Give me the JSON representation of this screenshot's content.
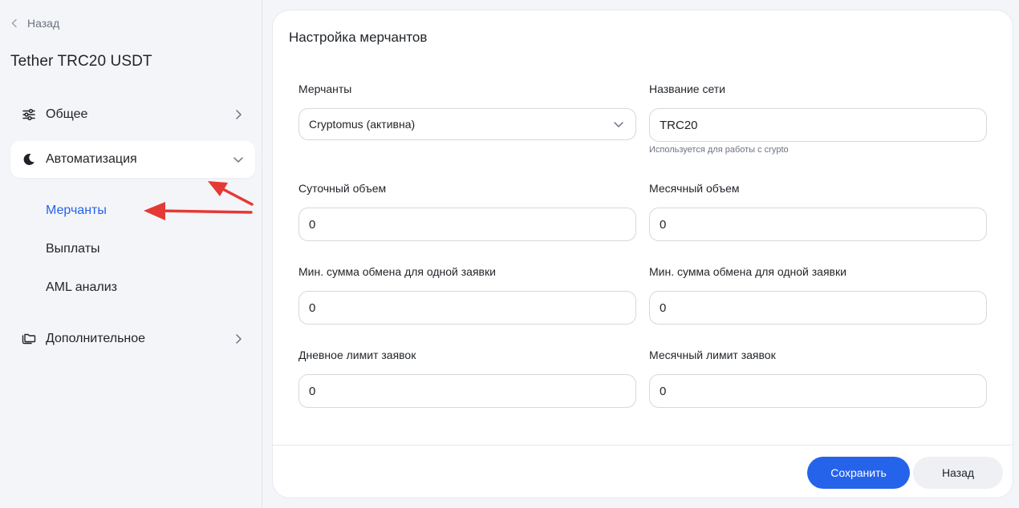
{
  "sidebar": {
    "back_label": "Назад",
    "asset_title": "Tether TRC20 USDT",
    "nav": [
      {
        "label": "Общее",
        "icon": "sliders-icon",
        "expanded": false
      },
      {
        "label": "Автоматизация",
        "icon": "moon-icon",
        "expanded": true
      },
      {
        "label": "Дополнительное",
        "icon": "folders-icon",
        "expanded": false
      }
    ],
    "sub_items": [
      {
        "label": "Мерчанты",
        "selected": true
      },
      {
        "label": "Выплаты",
        "selected": false
      },
      {
        "label": "AML анализ",
        "selected": false
      }
    ]
  },
  "card": {
    "title": "Настройка мерчантов",
    "fields": {
      "merchants": {
        "label": "Мерчанты",
        "value": "Cryptomus (активна)"
      },
      "network_name": {
        "label": "Название сети",
        "value": "TRC20",
        "hint": "Используется для работы с crypto"
      },
      "daily_volume": {
        "label": "Суточный объем",
        "value": "0"
      },
      "monthly_volume": {
        "label": "Месячный объем",
        "value": "0"
      },
      "min_amount_left": {
        "label": "Мин. сумма обмена для одной заявки",
        "value": "0"
      },
      "min_amount_right": {
        "label": "Мин. сумма обмена для одной заявки",
        "value": "0"
      },
      "daily_limit": {
        "label": "Дневное лимит заявок",
        "value": "0"
      },
      "monthly_limit": {
        "label": "Месячный лимит заявок",
        "value": "0"
      }
    },
    "save_label": "Сохранить",
    "back_label": "Назад"
  },
  "colors": {
    "accent": "#2563eb",
    "annotation": "#e53935",
    "background": "#f4f5f8"
  }
}
